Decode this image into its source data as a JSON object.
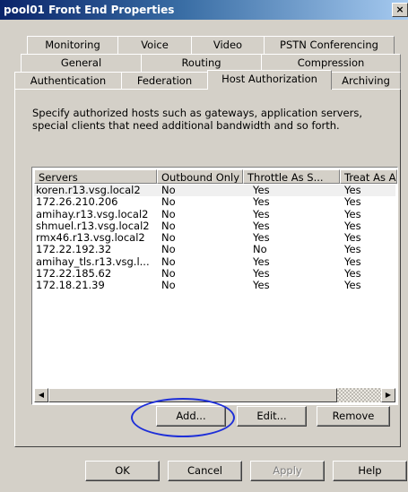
{
  "window": {
    "title": "pool01 Front End Properties",
    "close_label": "×"
  },
  "tabs": {
    "row1": [
      "Monitoring",
      "Voice",
      "Video",
      "PSTN Conferencing"
    ],
    "row2": [
      "General",
      "Routing",
      "Compression"
    ],
    "row3": [
      "Authentication",
      "Federation",
      "Host Authorization",
      "Archiving"
    ],
    "active": "Host Authorization"
  },
  "description": "Specify authorized hosts such as gateways, application servers, special clients that need additional bandwidth and so forth.",
  "list": {
    "columns": [
      "Servers",
      "Outbound Only",
      "Throttle As S...",
      "Treat As A"
    ],
    "rows": [
      [
        "koren.r13.vsg.local2",
        "No",
        "Yes",
        "Yes"
      ],
      [
        "172.26.210.206",
        "No",
        "Yes",
        "Yes"
      ],
      [
        "amihay.r13.vsg.local2",
        "No",
        "Yes",
        "Yes"
      ],
      [
        "shmuel.r13.vsg.local2",
        "No",
        "Yes",
        "Yes"
      ],
      [
        "rmx46.r13.vsg.local2",
        "No",
        "Yes",
        "Yes"
      ],
      [
        "172.22.192.32",
        "No",
        "No",
        "Yes"
      ],
      [
        "amihay_tls.r13.vsg.l...",
        "No",
        "Yes",
        "Yes"
      ],
      [
        "172.22.185.62",
        "No",
        "Yes",
        "Yes"
      ],
      [
        "172.18.21.39",
        "No",
        "Yes",
        "Yes"
      ]
    ],
    "scroll_left": "◀",
    "scroll_right": "▶"
  },
  "list_buttons": {
    "add": "Add...",
    "edit": "Edit...",
    "remove": "Remove"
  },
  "dialog_buttons": {
    "ok": "OK",
    "cancel": "Cancel",
    "apply": "Apply",
    "help": "Help"
  },
  "colors": {
    "annotation": "#1e2fd8",
    "title_bar": "#0a246a",
    "face": "#d4d0c8"
  }
}
